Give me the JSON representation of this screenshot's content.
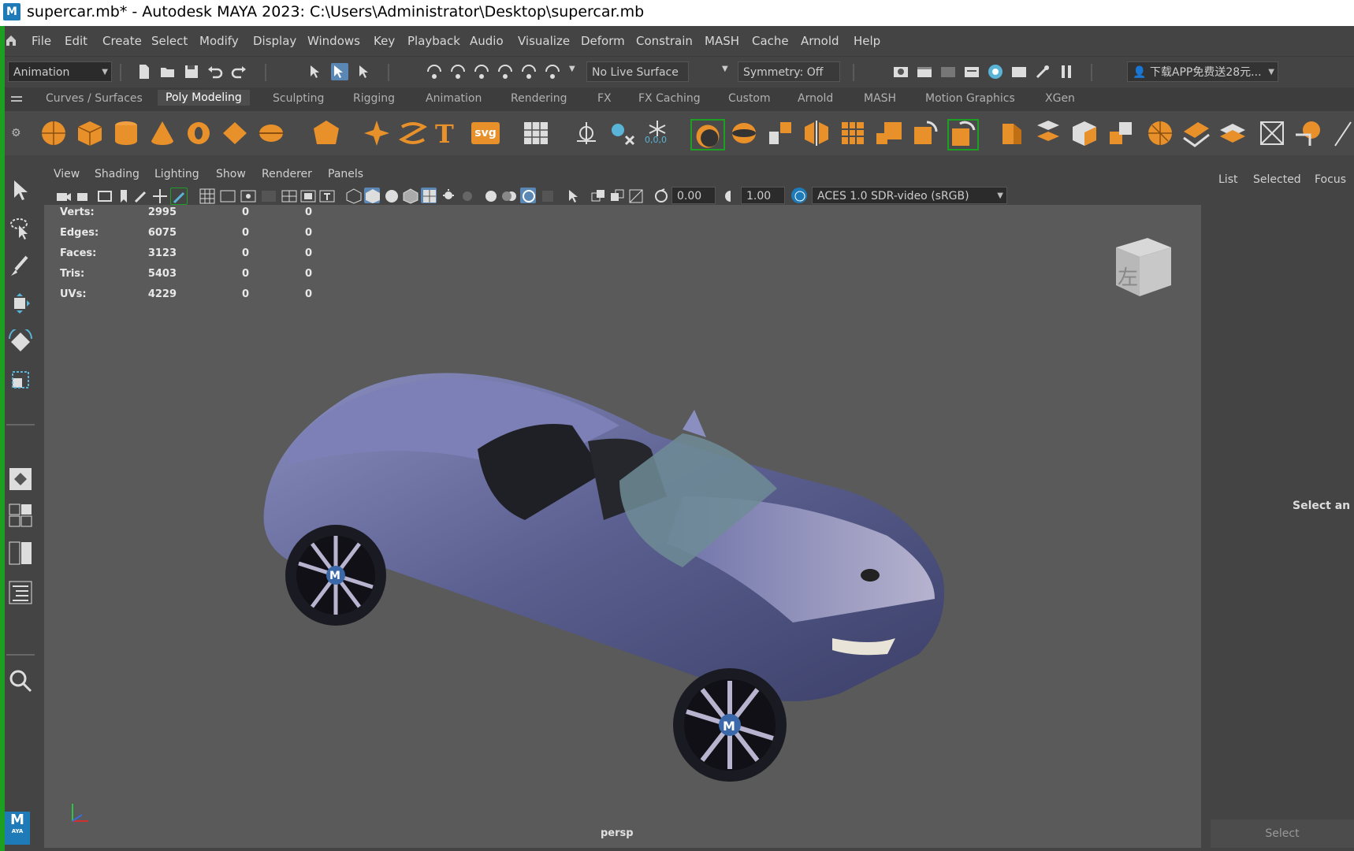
{
  "window": {
    "title": "supercar.mb* - Autodesk MAYA 2023: C:\\Users\\Administrator\\Desktop\\supercar.mb",
    "app_icon": "M"
  },
  "menubar": [
    "File",
    "Edit",
    "Create",
    "Select",
    "Modify",
    "Display",
    "Windows",
    "Key",
    "Playback",
    "Audio",
    "Visualize",
    "Deform",
    "Constrain",
    "MASH",
    "Cache",
    "Arnold",
    "Help"
  ],
  "statusline": {
    "mode": "Animation",
    "live_surface": "No Live Surface",
    "symmetry": "Symmetry: Off",
    "promo": "下载APP免费送28元..."
  },
  "shelf_tabs": [
    "Curves / Surfaces",
    "Poly Modeling",
    "Sculpting",
    "Rigging",
    "Animation",
    "Rendering",
    "FX",
    "FX Caching",
    "Custom",
    "Arnold",
    "MASH",
    "Motion Graphics",
    "XGen"
  ],
  "shelf_active": "Poly Modeling",
  "shelf_text_icons": {
    "text_tool": "T",
    "svg_tool": "svg",
    "freeze_label": "0,0,0"
  },
  "panel_menu": [
    "View",
    "Shading",
    "Lighting",
    "Show",
    "Renderer",
    "Panels"
  ],
  "panel_toolbar": {
    "exposure": "0.00",
    "gamma": "1.00",
    "color_space": "ACES 1.0 SDR-video (sRGB)"
  },
  "hud": {
    "rows": [
      {
        "label": "Verts:",
        "v1": "2995",
        "v2": "0",
        "v3": "0"
      },
      {
        "label": "Edges:",
        "v1": "6075",
        "v2": "0",
        "v3": "0"
      },
      {
        "label": "Faces:",
        "v1": "3123",
        "v2": "0",
        "v3": "0"
      },
      {
        "label": "Tris:",
        "v1": "5403",
        "v2": "0",
        "v3": "0"
      },
      {
        "label": "UVs:",
        "v1": "4229",
        "v2": "0",
        "v3": "0"
      }
    ]
  },
  "viewport": {
    "camera_label": "persp",
    "viewcube_glyph": "左",
    "wheel_badge": "M"
  },
  "right_panel": {
    "tabs": [
      "List",
      "Selected",
      "Focus"
    ],
    "message": "Select an ol",
    "select_button": "Select"
  },
  "maya_badge": {
    "letter": "M",
    "sub": "AYA"
  },
  "colors": {
    "accent": "#1da022",
    "shelf_orange": "#e8902a",
    "maya_blue": "#1f7ab8",
    "car_body": "#5a5f8f"
  }
}
